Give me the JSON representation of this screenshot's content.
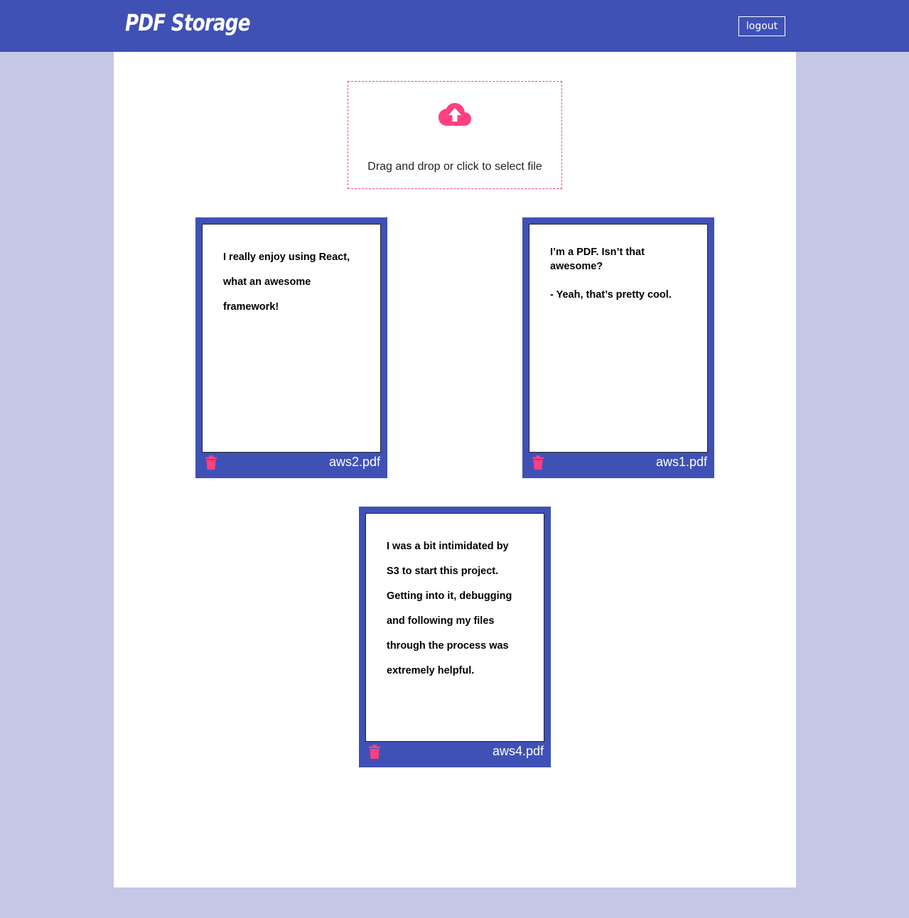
{
  "header": {
    "brand": "PDF Storage",
    "logout_label": "logout"
  },
  "upload": {
    "label": "Drag and drop or click to select file",
    "icon": "cloud-upload-icon"
  },
  "files": [
    {
      "name": "aws2.pdf",
      "lines": [
        "I really enjoy using React,",
        "what an awesome",
        "framework!"
      ]
    },
    {
      "name": "aws1.pdf",
      "lines": [
        "I’m a PDF. Isn’t that",
        "awesome?",
        "",
        "-  Yeah, that’s pretty cool."
      ]
    },
    {
      "name": "aws4.pdf",
      "lines": [
        "I was a bit intimidated by",
        "S3 to start this project.",
        "Getting into it, debugging",
        "and following my files",
        "through the process was",
        "extremely helpful."
      ]
    }
  ],
  "colors": {
    "primary": "#3f51b5",
    "accent": "#ff4081",
    "background": "#c5c7e6"
  }
}
